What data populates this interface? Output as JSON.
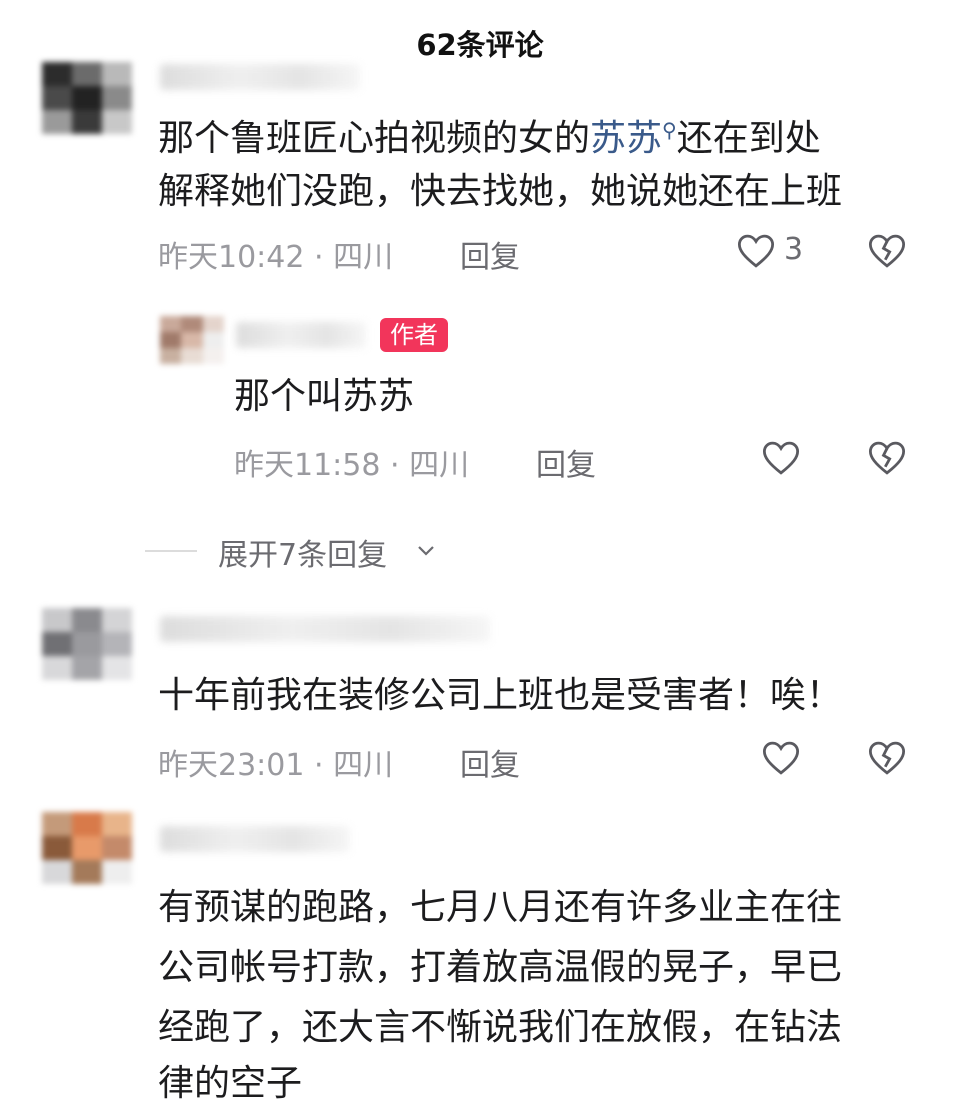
{
  "header": {
    "title": "62条评论"
  },
  "comments": [
    {
      "lines": [
        "那个鲁班匠心拍视频的女的",
        "苏苏",
        "还在到处",
        "解释她们没跑，快去找她，她说她还在上班"
      ],
      "time": "昨天10:42",
      "location": "四川",
      "reply_label": "回复",
      "likes": "3"
    },
    {
      "author_badge": "作者",
      "text": "那个叫苏苏",
      "time": "昨天11:58",
      "location": "四川",
      "reply_label": "回复"
    },
    {
      "text": "十年前我在装修公司上班也是受害者！唉！",
      "time": "昨天23:01",
      "location": "四川",
      "reply_label": "回复"
    },
    {
      "lines": [
        "有预谋的跑路，七月八月还有许多业主在往",
        "公司帐号打款，打着放高温假的晃子，早已",
        "经跑了，还大言不惭说我们在放假，在钻法",
        "律的空子"
      ]
    }
  ],
  "expand": {
    "label": "展开7条回复"
  },
  "meta_separator": "·",
  "colors": {
    "link": "#3a5a8a",
    "badge": "#f2355b",
    "meta": "#9a9a9f"
  },
  "icons": {
    "like": "heart-outline-icon",
    "dislike": "broken-heart-icon",
    "expand": "chevron-down-icon"
  }
}
